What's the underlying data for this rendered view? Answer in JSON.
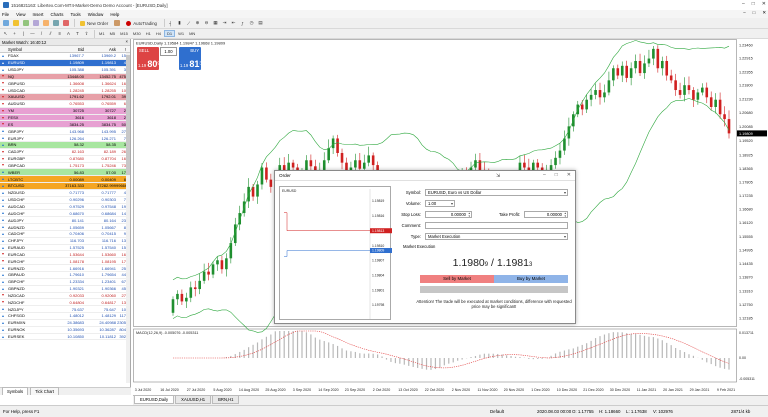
{
  "window": {
    "title": "1516821163: Libertex.Com-MT4-Market-Demo Demo Account - [EURUSD,Daily]",
    "min": "–",
    "max": "□",
    "close": "✕"
  },
  "menu": [
    "File",
    "View",
    "Insert",
    "Charts",
    "Tools",
    "Window",
    "Help"
  ],
  "mdi_controls": [
    "–",
    "□",
    "✕"
  ],
  "toolbar": {
    "new_order": "New Order",
    "autotrading": "AutoTrading"
  },
  "timeframes": [
    "M1",
    "M5",
    "M15",
    "M30",
    "H1",
    "H4",
    "D1",
    "W1",
    "MN"
  ],
  "active_timeframe": "D1",
  "market_watch": {
    "title": "Market Watch: 16:40:12",
    "close": "×",
    "headers": {
      "symbol": "Symbol",
      "bid": "Bid",
      "ask": "Ask",
      "spread": "!"
    },
    "rows": [
      {
        "symbol": "FDAX",
        "bid": "13967.7",
        "ask": "13969.2",
        "spread": "15",
        "bg": "#ffffff",
        "dir": "up"
      },
      {
        "symbol": "EURUSD",
        "bid": "1.19809",
        "ask": "1.19813",
        "spread": "4",
        "bg": "#2f6fcf",
        "fg": "#ffffff",
        "dir": "up"
      },
      {
        "symbol": "USDJPY",
        "bid": "105.388",
        "ask": "105.391",
        "spread": "3",
        "bg": "#ffffff",
        "dir": "up"
      },
      {
        "symbol": "NQ",
        "bid": "13448.00",
        "ask": "13452.75",
        "spread": "475",
        "bg": "#e7a0a8",
        "dir": "down"
      },
      {
        "symbol": "GBPUSD",
        "bid": "1.36608",
        "ask": "1.36624",
        "spread": "16",
        "bg": "#ffffff",
        "dir": "down"
      },
      {
        "symbol": "USDCAD",
        "bid": "1.28245",
        "ask": "1.28255",
        "spread": "10",
        "bg": "#ffffff",
        "dir": "down"
      },
      {
        "symbol": "XAUUSD",
        "bid": "1791.62",
        "ask": "1792.01",
        "spread": "39",
        "bg": "#e7a0a8",
        "dir": "down"
      },
      {
        "symbol": "AUDUSD",
        "bid": "0.76553",
        "ask": "0.76559",
        "spread": "6",
        "bg": "#ffffff",
        "dir": "down"
      },
      {
        "symbol": "YM",
        "bid": "30725",
        "ask": "30727",
        "spread": "2",
        "bg": "#e7a0d2",
        "dir": "down"
      },
      {
        "symbol": "FESX",
        "bid": "3616",
        "ask": "3618",
        "spread": "2",
        "bg": "#e7a0d2",
        "dir": "down"
      },
      {
        "symbol": "ES",
        "bid": "3834.25",
        "ask": "3834.75",
        "spread": "50",
        "bg": "#e7a0d2",
        "dir": "down"
      },
      {
        "symbol": "GBPJPY",
        "bid": "143.968",
        "ask": "143.995",
        "spread": "27",
        "bg": "#ffffff",
        "dir": "up"
      },
      {
        "symbol": "EURJPY",
        "bid": "126.264",
        "ask": "126.271",
        "spread": "7",
        "bg": "#ffffff",
        "dir": "up"
      },
      {
        "symbol": "BRN",
        "bid": "58.32",
        "ask": "58.35",
        "spread": "3",
        "bg": "#a8e6a0",
        "dir": "up"
      },
      {
        "symbol": "CADJPY",
        "bid": "82.163",
        "ask": "82.189",
        "spread": "26",
        "bg": "#ffffff",
        "dir": "down"
      },
      {
        "symbol": "EURGBP",
        "bid": "0.87680",
        "ask": "0.87704",
        "spread": "16",
        "bg": "#ffffff",
        "dir": "down"
      },
      {
        "symbol": "GBPCAD",
        "bid": "1.75173",
        "ask": "1.75246",
        "spread": "73",
        "bg": "#ffffff",
        "dir": "down"
      },
      {
        "symbol": "WBER",
        "bid": "56.83",
        "ask": "57.00",
        "spread": "17",
        "bg": "#a8e6a0",
        "dir": "up"
      },
      {
        "symbol": "LTCBTC",
        "bid": "0.00089",
        "ask": "0.00409",
        "spread": "8",
        "bg": "#f5a623",
        "dir": "up"
      },
      {
        "symbol": "BTCUSD",
        "bid": "37163.333",
        "ask": "37282.999",
        "spread": "99666",
        "bg": "#f5a623",
        "dir": "up"
      },
      {
        "symbol": "NZDUSD",
        "bid": "0.71773",
        "ask": "0.71777",
        "spread": "4",
        "bg": "#ffffff",
        "dir": "up"
      },
      {
        "symbol": "USDCHF",
        "bid": "0.90296",
        "ask": "0.90303",
        "spread": "7",
        "bg": "#ffffff",
        "dir": "up"
      },
      {
        "symbol": "AUDCAD",
        "bid": "0.97529",
        "ask": "0.97548",
        "spread": "19",
        "bg": "#ffffff",
        "dir": "up"
      },
      {
        "symbol": "AUDCHF",
        "bid": "0.68670",
        "ask": "0.68684",
        "spread": "14",
        "bg": "#ffffff",
        "dir": "up"
      },
      {
        "symbol": "AUDJPY",
        "bid": "80.141",
        "ask": "80.164",
        "spread": "23",
        "bg": "#ffffff",
        "dir": "up"
      },
      {
        "symbol": "AUDNZD",
        "bid": "1.05659",
        "ask": "1.05667",
        "spread": "8",
        "bg": "#ffffff",
        "dir": "up"
      },
      {
        "symbol": "CADCHF",
        "bid": "0.70406",
        "ask": "0.70415",
        "spread": "9",
        "bg": "#ffffff",
        "dir": "up"
      },
      {
        "symbol": "CHFJPY",
        "bid": "116.703",
        "ask": "116.716",
        "spread": "13",
        "bg": "#ffffff",
        "dir": "up"
      },
      {
        "symbol": "EURAUD",
        "bid": "1.57525",
        "ask": "1.57540",
        "spread": "15",
        "bg": "#ffffff",
        "dir": "up"
      },
      {
        "symbol": "EURCAD",
        "bid": "1.53644",
        "ask": "1.53660",
        "spread": "16",
        "bg": "#ffffff",
        "dir": "down"
      },
      {
        "symbol": "EURCHF",
        "bid": "1.08178",
        "ask": "1.08195",
        "spread": "17",
        "bg": "#ffffff",
        "dir": "down"
      },
      {
        "symbol": "EURNZD",
        "bid": "1.66916",
        "ask": "1.66941",
        "spread": "25",
        "bg": "#ffffff",
        "dir": "up"
      },
      {
        "symbol": "GBPAUD",
        "bid": "1.79610",
        "ask": "1.79654",
        "spread": "44",
        "bg": "#ffffff",
        "dir": "up"
      },
      {
        "symbol": "GBPCHF",
        "bid": "1.23334",
        "ask": "1.23401",
        "spread": "67",
        "bg": "#ffffff",
        "dir": "up"
      },
      {
        "symbol": "GBPNZD",
        "bid": "1.90321",
        "ask": "1.90366",
        "spread": "45",
        "bg": "#ffffff",
        "dir": "up"
      },
      {
        "symbol": "NZDCAD",
        "bid": "0.92033",
        "ask": "0.92060",
        "spread": "27",
        "bg": "#ffffff",
        "dir": "down"
      },
      {
        "symbol": "NZDCHF",
        "bid": "0.64804",
        "ask": "0.64817",
        "spread": "13",
        "bg": "#ffffff",
        "dir": "down"
      },
      {
        "symbol": "NZDJPY",
        "bid": "75.637",
        "ask": "75.647",
        "spread": "10",
        "bg": "#ffffff",
        "dir": "up"
      },
      {
        "symbol": "CHFSGD",
        "bid": "1.48012",
        "ask": "1.48129",
        "spread": "117",
        "bg": "#ffffff",
        "dir": "up"
      },
      {
        "symbol": "EURMXN",
        "bid": "24.38683",
        "ask": "24.40988",
        "spread": "2305",
        "bg": "#ffffff",
        "dir": "up"
      },
      {
        "symbol": "EURNOK",
        "bid": "10.35693",
        "ask": "10.36287",
        "spread": "804",
        "bg": "#ffffff",
        "dir": "up"
      },
      {
        "symbol": "EURSEK",
        "bid": "10.10850",
        "ask": "10.11812",
        "spread": "392",
        "bg": "#ffffff",
        "dir": "up"
      }
    ],
    "tabs": [
      "Symbols",
      "Tick Chart"
    ],
    "active_tab": "Symbols"
  },
  "chart": {
    "info": "EURUSD,Daily  1.19584 1.19847 1.19668 1.19809",
    "oct": {
      "sell": "SELL",
      "buy": "BUY",
      "lot": "1.00",
      "sell_big": "80",
      "sell_pre": "1.19",
      "sell_sup": "9",
      "buy_big": "81",
      "buy_pre": "1.19",
      "buy_sup": "3"
    },
    "macd_label": "MACD(12,26,9) -0.005076 -0.005311",
    "price_axis": [
      "1.23460",
      "1.22915",
      "1.22355",
      "1.21800",
      "1.21230",
      "1.20680",
      "1.20085",
      "1.19809",
      "1.19520",
      "1.18925",
      "1.18365",
      "1.17805",
      "1.17235",
      "1.16680",
      "1.16120",
      "1.15555",
      "1.14995",
      "1.14435",
      "1.13870",
      "1.13310",
      "1.12750",
      "1.12185"
    ],
    "current_price": "1.19809",
    "macd_axis": [
      "0.013711",
      "0.00",
      "-0.005311"
    ],
    "time_axis": [
      "3 Jul 2020",
      "16 Jul 2020",
      "27 Jul 2020",
      "5 Aug 2020",
      "14 Aug 2020",
      "25 Aug 2020",
      "3 Sep 2020",
      "14 Sep 2020",
      "23 Sep 2020",
      "2 Oct 2020",
      "13 Oct 2020",
      "22 Oct 2020",
      "2 Nov 2020",
      "11 Nov 2020",
      "20 Nov 2020",
      "1 Dec 2020",
      "10 Dec 2020",
      "21 Dec 2020",
      "30 Dec 2020",
      "11 Jan 2021",
      "20 Jan 2021",
      "29 Jan 2021",
      "9 Feb 2021"
    ],
    "tabs": [
      "EURUSD,Daily",
      "XAUUSD,H1",
      "BRN,H1"
    ],
    "active_tab": "EURUSD,Daily"
  },
  "order": {
    "title": "Order",
    "symbol_label": "Symbol:",
    "symbol_value": "EURUSD, Euro vs US Dollar",
    "volume_label": "Volume:",
    "volume_value": "1.00",
    "sl_label": "Stop Loss:",
    "sl_value": "0.00000",
    "tp_label": "Take Profit:",
    "tp_value": "0.00000",
    "comment_label": "Comment:",
    "comment_value": "",
    "type_label": "Type:",
    "type_value": "Market Execution",
    "exec_label": "Market Execution",
    "bid_main": "1.1980",
    "bid_sub": "9",
    "sep": " / ",
    "ask_main": "1.1981",
    "ask_sub": "3",
    "sell_btn": "Sell by Market",
    "buy_btn": "Buy by Market",
    "attention": "Attention! The trade will be executed at market conditions, difference with requested price may be significant!",
    "chart_title": "EURUSD",
    "chart_axis": [
      "1.19819",
      "1.19816",
      "1.19813",
      "1.19810",
      "1.19807",
      "1.19804",
      "1.19801",
      "1.19798"
    ],
    "chart_ask": "1.19813",
    "chart_bid": "1.19809",
    "controls": [
      "–",
      "□",
      "✕"
    ],
    "pin": "⇲"
  },
  "status": {
    "help": "For Help, press F1",
    "profile": "Default",
    "datetime": "2020.08.03 00:00",
    "o": "O: 1.17755",
    "h": "H: 1.18660",
    "l": "L: 1.17638",
    "v": "V: 102976",
    "traffic": "2871/4 kb"
  },
  "colors": {
    "up_candle": "#1f8f2f",
    "down_candle": "#d02020",
    "band": "#2fa83f",
    "buy": "#2f6fcf",
    "sell": "#d44",
    "macd_signal": "#e03030"
  }
}
